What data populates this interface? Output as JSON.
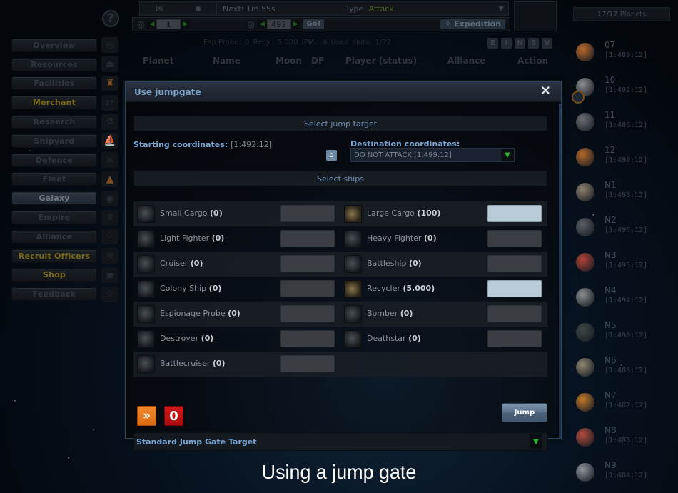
{
  "sidebar": {
    "help_icon": "?",
    "items": [
      {
        "label": "Overview",
        "icon": "overview-icon",
        "glyph": "◎",
        "style": "dim"
      },
      {
        "label": "Resources",
        "icon": "resources-icon",
        "glyph": "⏏",
        "style": "dim"
      },
      {
        "label": "Facilities",
        "icon": "facilities-icon",
        "glyph": "♜",
        "style": "dim",
        "icon_style": "orange"
      },
      {
        "label": "Merchant",
        "icon": "merchant-icon",
        "glyph": "⇄",
        "style": "gold"
      },
      {
        "label": "Research",
        "icon": "research-icon",
        "glyph": "⚗",
        "style": "dim"
      },
      {
        "label": "Shipyard",
        "icon": "shipyard-icon",
        "glyph": "⛵",
        "style": "dim"
      },
      {
        "label": "Defence",
        "icon": "defence-icon",
        "glyph": "⚔",
        "style": "dim"
      },
      {
        "label": "Fleet",
        "icon": "fleet-icon",
        "glyph": "▲",
        "style": "dim",
        "icon_style": "orange"
      },
      {
        "label": "Galaxy",
        "icon": "galaxy-icon",
        "glyph": "◉",
        "style": "active"
      },
      {
        "label": "Empire",
        "icon": "empire-icon",
        "glyph": "♆",
        "style": "dim"
      },
      {
        "label": "Alliance",
        "icon": "alliance-icon",
        "glyph": "⁘",
        "style": "dim"
      },
      {
        "label": "Recruit Officers",
        "icon": "officers-icon",
        "glyph": "≋",
        "style": "gold"
      },
      {
        "label": "Shop",
        "icon": "shop-icon",
        "glyph": "▣",
        "style": "gold"
      },
      {
        "label": "Feedback",
        "icon": "feedback-icon",
        "glyph": "⁘",
        "style": "dim"
      }
    ]
  },
  "topbar": {
    "next": "Next: 1m 55s",
    "type_label": "Type:",
    "type_value": "Attack",
    "galaxy": "1",
    "system": "492",
    "go_label": "Go!",
    "expedition_label": "Expedition"
  },
  "galaxy_view": {
    "stats": "Esp.Probe: 0   Recy.: 5.000   IPM.: 0   Used slots: 1/22",
    "filters": [
      "E",
      "I",
      "N",
      "S",
      "V"
    ],
    "columns": [
      "Planet",
      "Name",
      "Moon",
      "DF",
      "Player (status)",
      "Alliance",
      "Action"
    ]
  },
  "planets": {
    "count_label": "17/17 Planets",
    "items": [
      {
        "name": "07",
        "coords": "[1:489:12]",
        "color": "#b96a2c"
      },
      {
        "name": "10",
        "coords": "[1:492:12]",
        "color": "#8b8d90",
        "moon": true
      },
      {
        "name": "11",
        "coords": "[1:486:12]",
        "color": "#6a6e74"
      },
      {
        "name": "12",
        "coords": "[1:499:12]",
        "color": "#b2682a"
      },
      {
        "name": "N1",
        "coords": "[1:498:12]",
        "color": "#8d8170"
      },
      {
        "name": "N2",
        "coords": "[1:496:12]",
        "color": "#5a5e66"
      },
      {
        "name": "N3",
        "coords": "[1:495:12]",
        "color": "#b0433a"
      },
      {
        "name": "N4",
        "coords": "[1:494:12]",
        "color": "#8a8f94"
      },
      {
        "name": "N5",
        "coords": "[1:490:12]",
        "color": "#3c4846"
      },
      {
        "name": "N6",
        "coords": "[1:488:12]",
        "color": "#8d8672"
      },
      {
        "name": "N7",
        "coords": "[1:487:12]",
        "color": "#c07a2a"
      },
      {
        "name": "N8",
        "coords": "[1:485:12]",
        "color": "#b14a3e"
      },
      {
        "name": "N9",
        "coords": "[1:484:12]",
        "color": "#8f959c"
      }
    ]
  },
  "modal": {
    "title": "Use jumpgate",
    "close_label": "✕",
    "select_target_label": "Select jump target",
    "start_label": "Starting coordinates:",
    "start_value": "[1:492:12]",
    "dest_label": "Destination coordinates:",
    "dest_value": "DO NOT ATTACK [1:499:12]",
    "select_ships_label": "Select ships",
    "ships": [
      [
        {
          "name": "Small Cargo",
          "count": "(0)",
          "value": "",
          "filled": false
        },
        {
          "name": "Large Cargo",
          "count": "(100)",
          "value": "",
          "filled": true,
          "gold": true
        }
      ],
      [
        {
          "name": "Light Fighter",
          "count": "(0)",
          "value": "",
          "filled": false
        },
        {
          "name": "Heavy Fighter",
          "count": "(0)",
          "value": "",
          "filled": false
        }
      ],
      [
        {
          "name": "Cruiser",
          "count": "(0)",
          "value": "",
          "filled": false
        },
        {
          "name": "Battleship",
          "count": "(0)",
          "value": "",
          "filled": false
        }
      ],
      [
        {
          "name": "Colony Ship",
          "count": "(0)",
          "value": "",
          "filled": false
        },
        {
          "name": "Recycler",
          "count": "(5.000)",
          "value": "",
          "filled": true,
          "gold": true
        }
      ],
      [
        {
          "name": "Espionage Probe",
          "count": "(0)",
          "value": "",
          "filled": false
        },
        {
          "name": "Bomber",
          "count": "(0)",
          "value": "",
          "filled": false
        }
      ],
      [
        {
          "name": "Destroyer",
          "count": "(0)",
          "value": "",
          "filled": false
        },
        {
          "name": "Deathstar",
          "count": "(0)",
          "value": "",
          "filled": false
        }
      ],
      [
        {
          "name": "Battlecruiser",
          "count": "(0)",
          "value": "",
          "filled": false
        },
        null
      ]
    ],
    "select_all_label": "»",
    "reset_label": "0",
    "jump_label": "Jump",
    "standard_target_label": "Standard Jump Gate Target"
  },
  "caption": "Using a jump gate",
  "colors": {
    "accent_blue": "#7aa6d3",
    "gold": "#7b6a17",
    "attack_green": "#546621",
    "dropdown_green": "#29b52e",
    "select_all_orange": "#e57a20",
    "reset_red": "#c01414"
  }
}
